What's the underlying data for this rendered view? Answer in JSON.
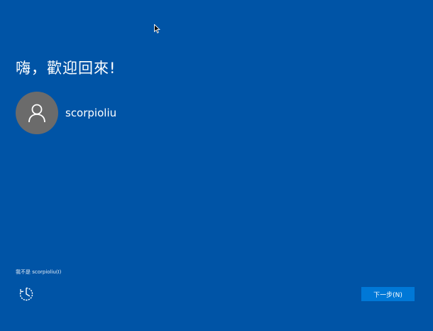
{
  "greeting": "嗨，歡迎回來!",
  "account": {
    "username": "scorpioliu",
    "avatar_icon": "user-person-icon"
  },
  "not_me_link": "我不是 scorpioliu(I)",
  "ease_of_access_icon": "ease-of-access-icon",
  "next_button": "下一步(N)",
  "colors": {
    "background": "#0054a6",
    "button": "#0078d7",
    "avatar": "#6b6b6b"
  }
}
